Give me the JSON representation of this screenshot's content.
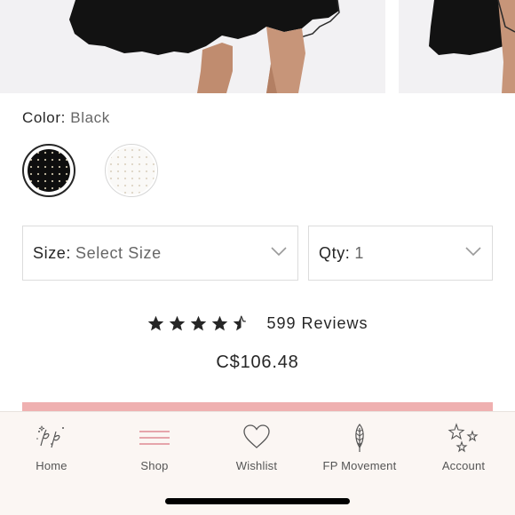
{
  "product": {
    "color_label": "Color:",
    "color_value": "Black",
    "swatches": [
      {
        "name": "Black",
        "selected": true
      },
      {
        "name": "White",
        "selected": false
      }
    ],
    "size_label": "Size:",
    "size_value": "Select Size",
    "qty_label": "Qty:",
    "qty_value": "1",
    "rating": 4.5,
    "reviews_text": "599 Reviews",
    "price": "C$106.48"
  },
  "colors": {
    "accent": "#efb0b0",
    "tabbar_bg": "#fbf6f3",
    "text": "#262626",
    "muted": "#666666"
  },
  "tabbar": {
    "items": [
      {
        "label": "Home",
        "icon": "fp-logo-icon"
      },
      {
        "label": "Shop",
        "icon": "menu-lines-icon"
      },
      {
        "label": "Wishlist",
        "icon": "heart-icon"
      },
      {
        "label": "FP Movement",
        "icon": "feather-icon"
      },
      {
        "label": "Account",
        "icon": "stars-icon"
      }
    ]
  }
}
